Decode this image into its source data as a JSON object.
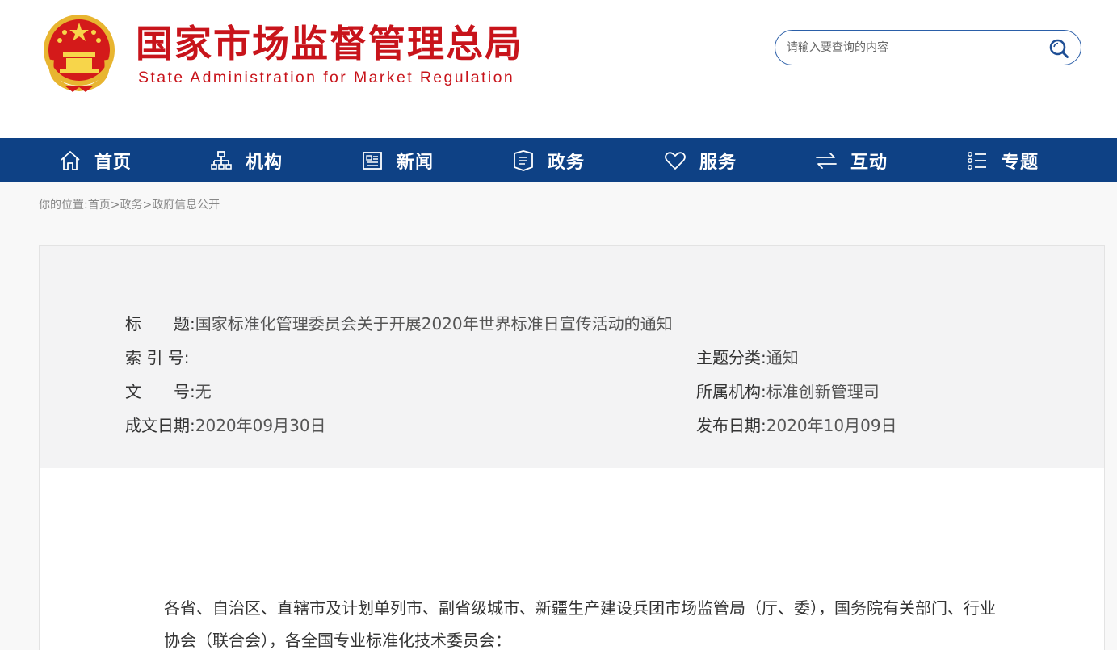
{
  "header": {
    "title_cn": "国家市场监督管理总局",
    "title_en": "State Administration for Market Regulation",
    "search_placeholder": "请输入要查询的内容",
    "brand_red": "#c8141b",
    "emblem_icon": "national-emblem-icon",
    "search_icon": "search-icon"
  },
  "nav": {
    "bg_color": "#0e4185",
    "items": [
      {
        "label": "首页",
        "icon": "home-icon"
      },
      {
        "label": "机构",
        "icon": "org-chart-icon"
      },
      {
        "label": "新闻",
        "icon": "newspaper-icon"
      },
      {
        "label": "政务",
        "icon": "government-icon"
      },
      {
        "label": "服务",
        "icon": "heart-icon"
      },
      {
        "label": "互动",
        "icon": "exchange-arrows-icon"
      },
      {
        "label": "专题",
        "icon": "topics-list-icon"
      }
    ]
  },
  "breadcrumb": {
    "prefix": "你的位置:",
    "items": [
      "首页",
      "政务",
      "政府信息公开"
    ],
    "separator": ">"
  },
  "meta": {
    "title_key": "标　　题:",
    "title_value": "国家标准化管理委员会关于开展2020年世界标准日宣传活动的通知",
    "index_key": "索 引 号:",
    "index_value": "",
    "category_key": "主题分类:",
    "category_value": "通知",
    "doc_no_key": "文　　号:",
    "doc_no_value": "无",
    "org_key": "所属机构:",
    "org_value": "标准创新管理司",
    "created_key": "成文日期:",
    "created_value": "2020年09月30日",
    "published_key": "发布日期:",
    "published_value": "2020年10月09日"
  },
  "body": {
    "paragraph_1": "各省、自治区、直辖市及计划单列市、副省级城市、新疆生产建设兵团市场监管局（厅、委），国务院有关部门、行业协会（联合会），各全国专业标准化技术委员会："
  }
}
